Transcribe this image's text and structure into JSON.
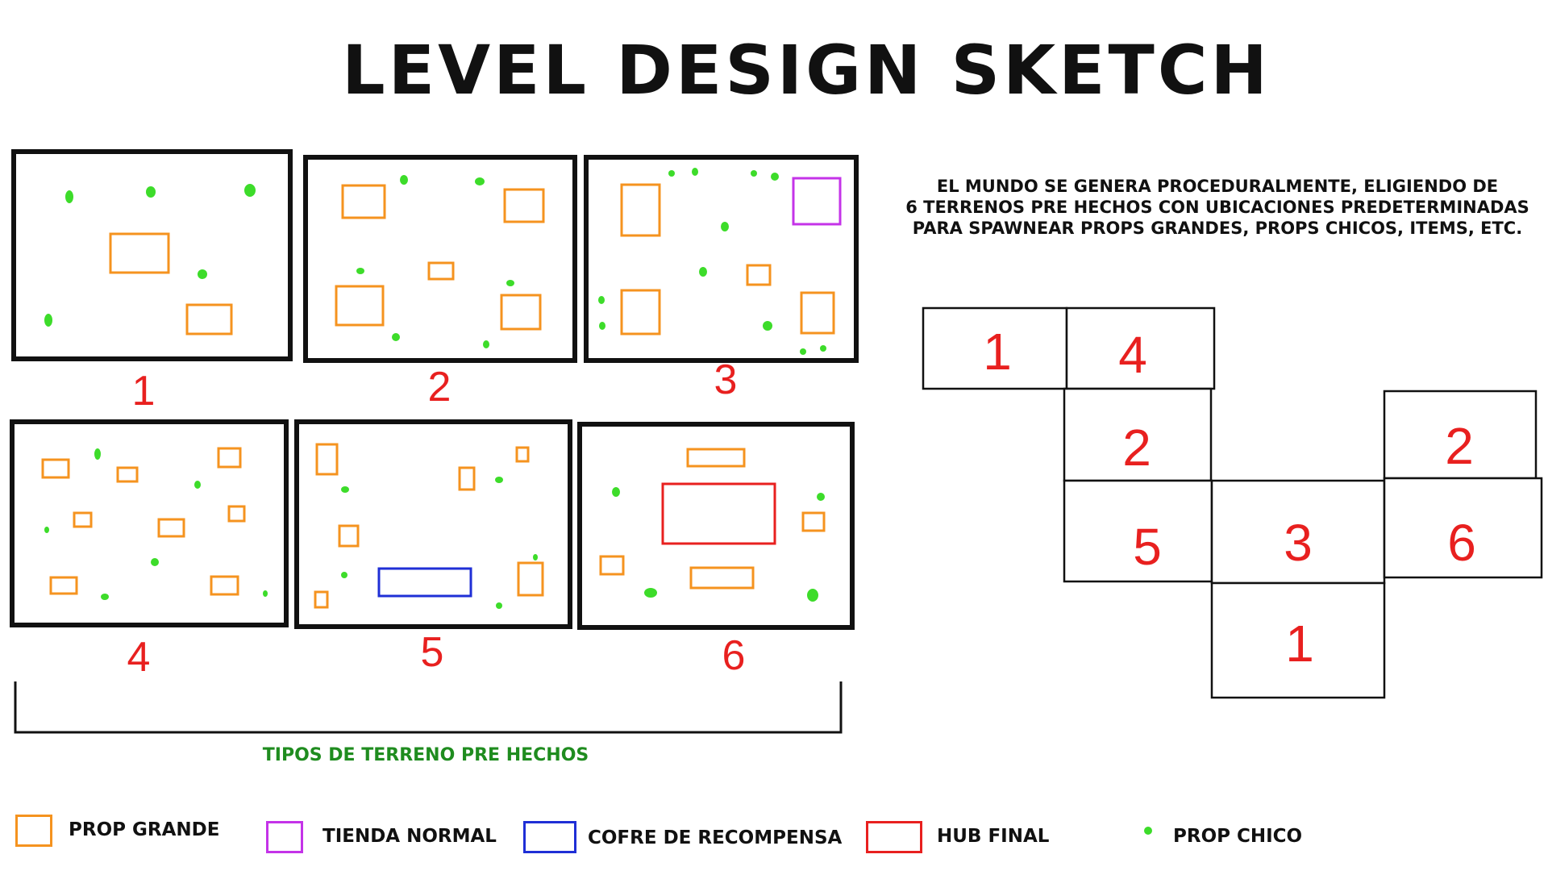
{
  "title": "LEVEL DESIGN SKETCH",
  "description": [
    "EL MUNDO SE GENERA PROCEDURALMENTE, ELIGIENDO DE",
    "6 TERRENOS PRE HECHOS CON UBICACIONES PREDETERMINADAS",
    "PARA SPAWNEAR PROPS GRANDES, PROPS CHICOS, ITEMS, ETC."
  ],
  "brace_label": "TIPOS DE TERRENO PRE HECHOS",
  "colors": {
    "prop_grande": "#f5931f",
    "tienda_normal": "#c433e8",
    "cofre_recompensa": "#1f2fd6",
    "hub_final": "#e8201f",
    "prop_chico": "#3ddc2a",
    "number_red": "#e8201f",
    "outline": "#111111",
    "label_green": "#1f8c1f"
  },
  "terrains": [
    {
      "label": "1",
      "has_tienda": false,
      "has_cofre": false,
      "has_hub": false
    },
    {
      "label": "2",
      "has_tienda": false,
      "has_cofre": false,
      "has_hub": false
    },
    {
      "label": "3",
      "has_tienda": true,
      "has_cofre": false,
      "has_hub": false
    },
    {
      "label": "4",
      "has_tienda": false,
      "has_cofre": false,
      "has_hub": false
    },
    {
      "label": "5",
      "has_tienda": false,
      "has_cofre": true,
      "has_hub": false
    },
    {
      "label": "6",
      "has_tienda": false,
      "has_cofre": false,
      "has_hub": true
    }
  ],
  "map_tiles": [
    "1",
    "4",
    "2",
    "2",
    "5",
    "3",
    "6",
    "1"
  ],
  "legend": [
    {
      "type": "swatch",
      "color_key": "prop_grande",
      "label": "PROP GRANDE"
    },
    {
      "type": "swatch",
      "color_key": "tienda_normal",
      "label": "TIENDA NORMAL"
    },
    {
      "type": "swatch",
      "color_key": "cofre_recompensa",
      "label": "COFRE DE RECOMPENSA"
    },
    {
      "type": "swatch",
      "color_key": "hub_final",
      "label": "HUB FINAL"
    },
    {
      "type": "dot",
      "color_key": "prop_chico",
      "label": "PROP CHICO"
    }
  ]
}
